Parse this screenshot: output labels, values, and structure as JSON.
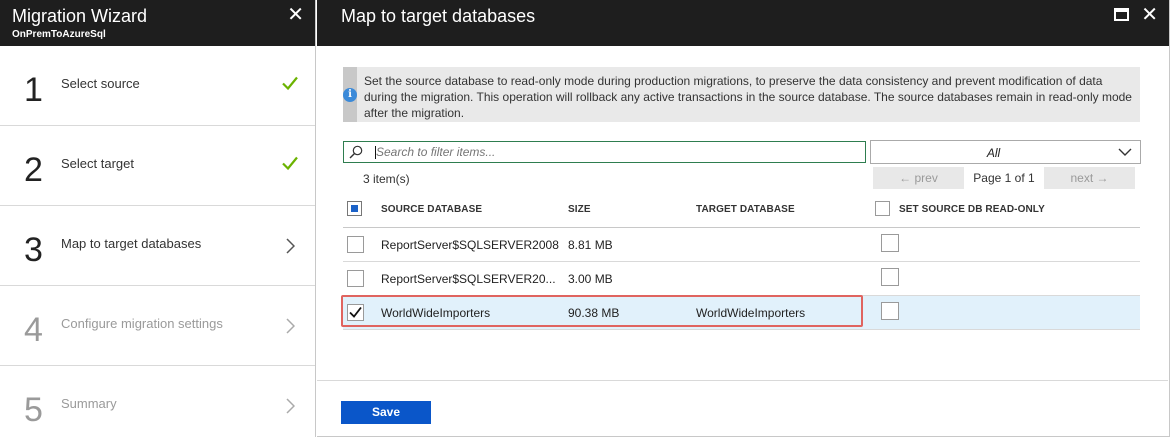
{
  "wizard": {
    "title": "Migration Wizard",
    "subtitle": "OnPremToAzureSql",
    "close_glyph": "✕",
    "steps": [
      {
        "num": "1",
        "label": "Select source",
        "status": "done"
      },
      {
        "num": "2",
        "label": "Select target",
        "status": "done"
      },
      {
        "num": "3",
        "label": "Map to target databases",
        "status": "current"
      },
      {
        "num": "4",
        "label": "Configure migration settings",
        "status": "disabled"
      },
      {
        "num": "5",
        "label": "Summary",
        "status": "disabled"
      }
    ]
  },
  "blade": {
    "title": "Map to target databases",
    "close_glyph": "✕",
    "info_text": "Set the source database to read-only mode during production migrations, to preserve the data consistency and prevent modification of data during the migration. This operation will rollback any active transactions in the source database. The source databases remain in read-only mode after the migration.",
    "info_icon": "i",
    "search_placeholder": "Search to filter items...",
    "filter_value": "All",
    "count_text": "3 item(s)",
    "pager": {
      "prev": "← prev",
      "page": "Page 1 of 1",
      "next": "next →"
    },
    "columns": {
      "source": "SOURCE DATABASE",
      "size": "SIZE",
      "target": "TARGET DATABASE",
      "readonly": "SET SOURCE DB READ-ONLY"
    },
    "rows": [
      {
        "source": "ReportServer$SQLSERVER2008",
        "size": "8.81 MB",
        "target": "",
        "selected": false,
        "readonly": false
      },
      {
        "source": "ReportServer$SQLSERVER20...",
        "size": "3.00 MB",
        "target": "",
        "selected": false,
        "readonly": false
      },
      {
        "source": "WorldWideImporters",
        "size": "90.38 MB",
        "target": "WorldWideImporters",
        "selected": true,
        "readonly": false
      }
    ],
    "save_label": "Save"
  },
  "colors": {
    "header_bg": "#1e1e1e",
    "check_green": "#6bb300",
    "primary_blue": "#0a56c9",
    "selected_row": "#e1f1fb",
    "highlight_red": "#e0645f"
  }
}
